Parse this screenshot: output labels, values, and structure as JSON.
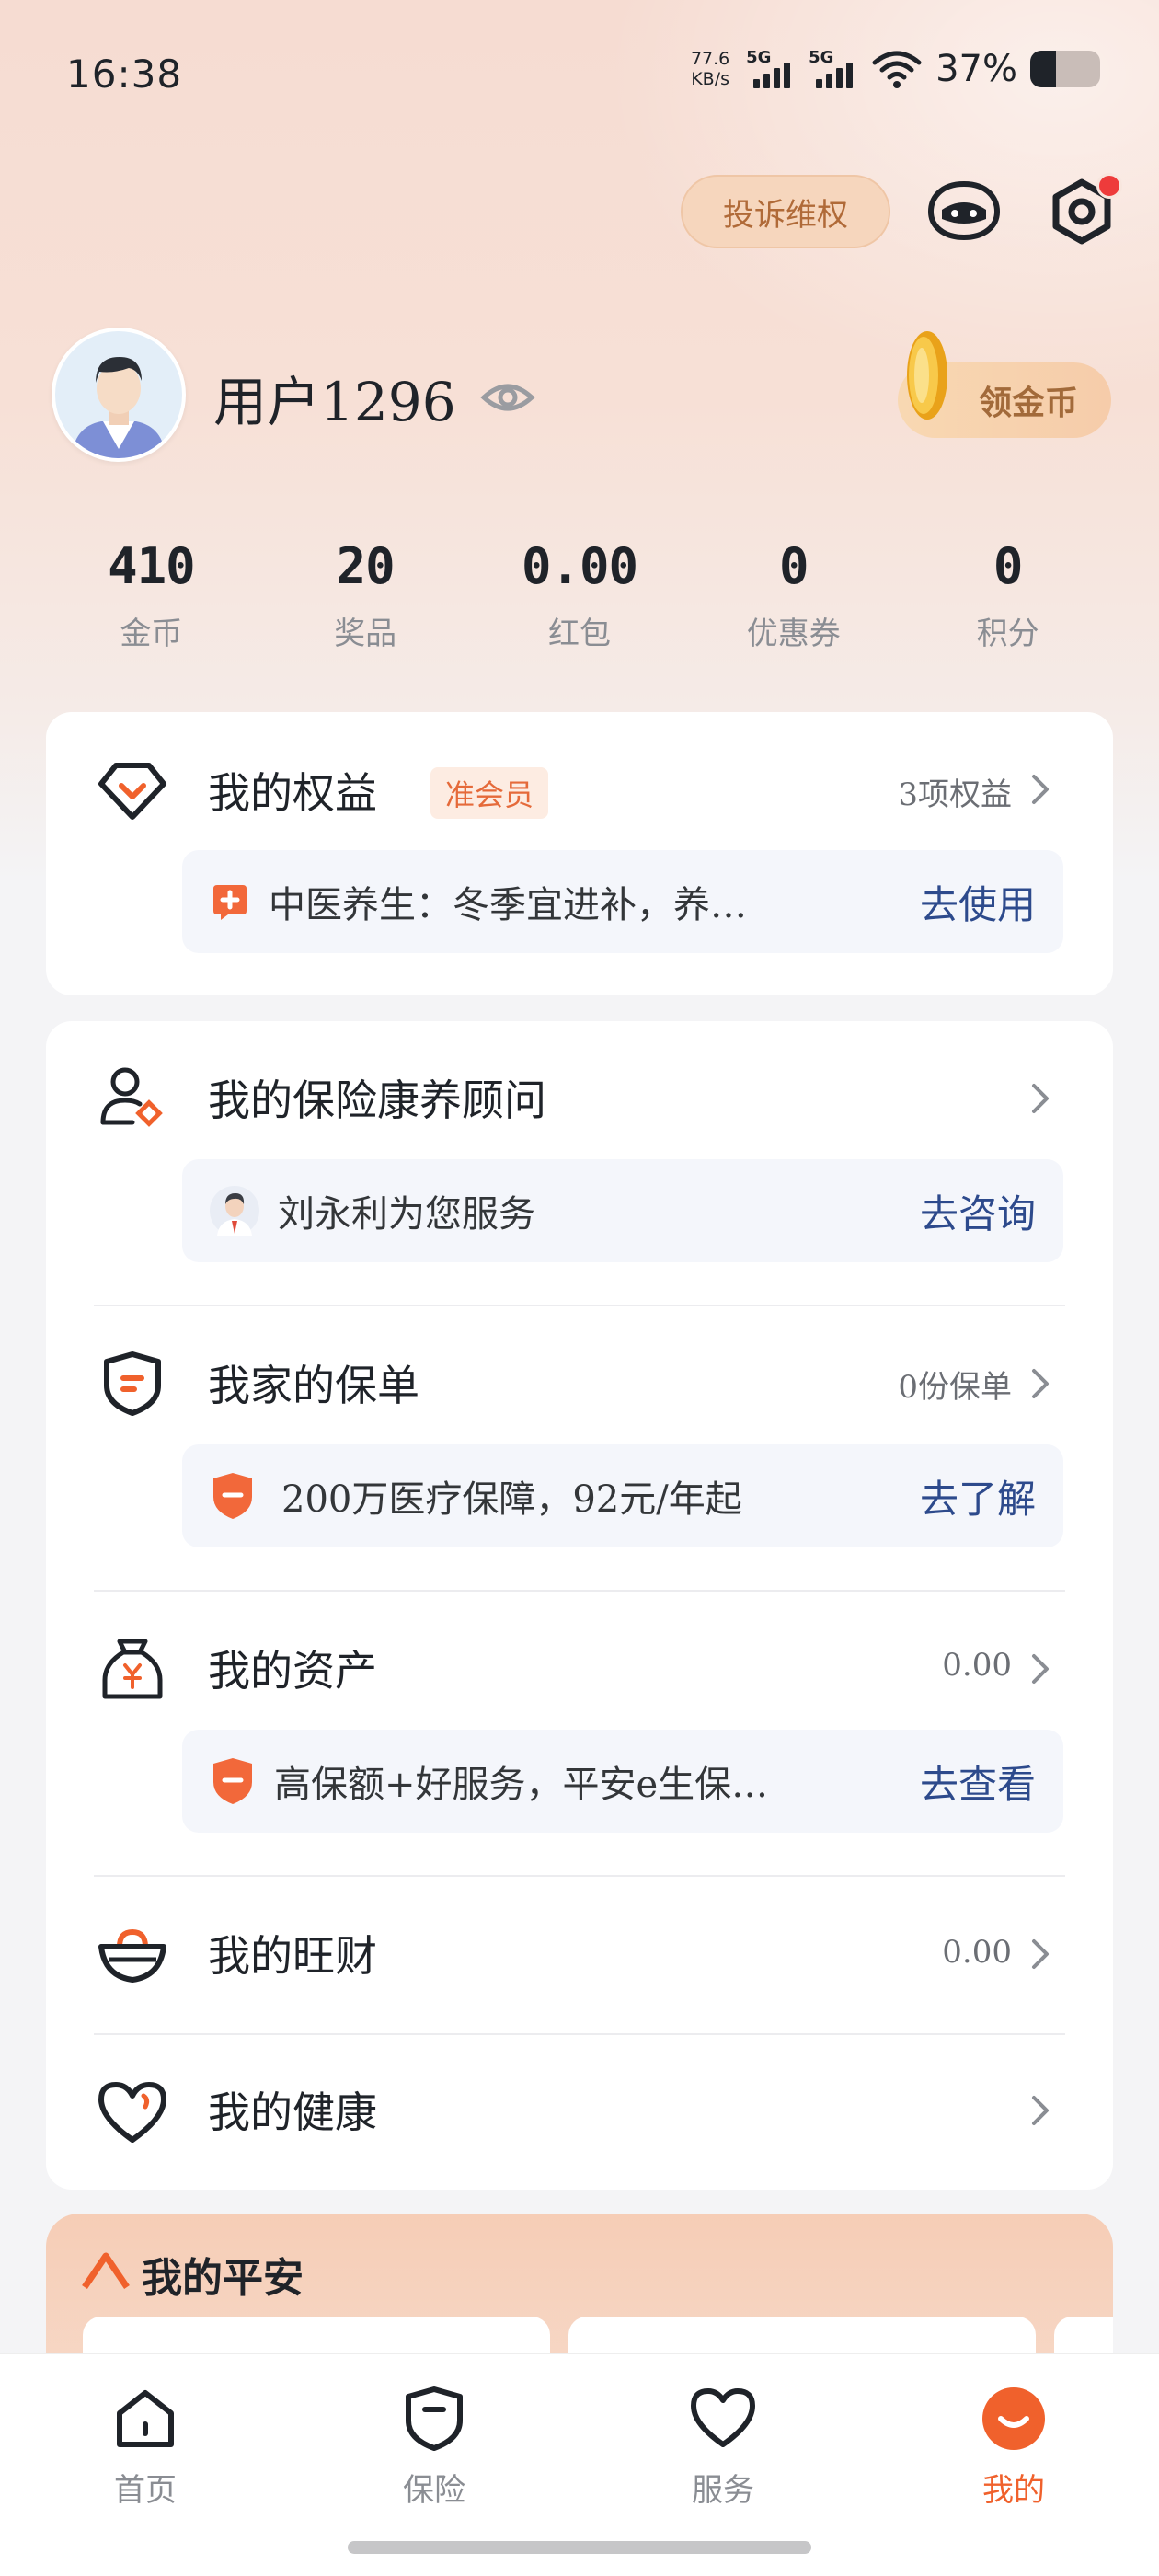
{
  "status_bar": {
    "time": "16:38",
    "net_speed_value": "77.6",
    "net_speed_unit": "KB/s",
    "signal_1_label": "5G",
    "signal_2_label": "5G",
    "battery_percent": "37%",
    "battery_level": 0.37
  },
  "header": {
    "complaint_label": "投诉维权",
    "robot_icon": "robot-chat-icon",
    "settings_icon": "settings-icon"
  },
  "profile": {
    "username": "用户1296",
    "visibility_icon": "eye-icon",
    "coin_button_label": "领金币"
  },
  "stats": [
    {
      "value": "410",
      "label": "金币"
    },
    {
      "value": "20",
      "label": "奖品"
    },
    {
      "value": "0.00",
      "label": "红包"
    },
    {
      "value": "0",
      "label": "优惠券"
    },
    {
      "value": "0",
      "label": "积分"
    }
  ],
  "benefits": {
    "title": "我的权益",
    "tag": "准会员",
    "right": "3项权益",
    "promo_text": "中医养生：冬季宜进补，养…",
    "promo_action": "去使用"
  },
  "advisor": {
    "title": "我的保险康养顾问",
    "promo_text": "刘永利为您服务",
    "promo_action": "去咨询"
  },
  "policy": {
    "title": "我家的保单",
    "right": "0份保单",
    "promo_text": "200万医疗保障，92元/年起",
    "promo_action": "去了解"
  },
  "assets": {
    "title": "我的资产",
    "right": "0.00",
    "promo_text": "高保额+好服务，平安e生保…",
    "promo_action": "去查看"
  },
  "wangcai": {
    "title": "我的旺财",
    "right": "0.00"
  },
  "health": {
    "title": "我的健康"
  },
  "my_pingan": {
    "title": "我的平安"
  },
  "bottom_nav": [
    {
      "label": "首页",
      "icon": "home-icon"
    },
    {
      "label": "保险",
      "icon": "shield-icon"
    },
    {
      "label": "服务",
      "icon": "heart-icon"
    },
    {
      "label": "我的",
      "icon": "me-smile-icon",
      "active": true
    }
  ],
  "colors": {
    "accent_orange": "#f0612c",
    "link_blue": "#2d4a8c",
    "tag_bg": "#fdece2"
  }
}
